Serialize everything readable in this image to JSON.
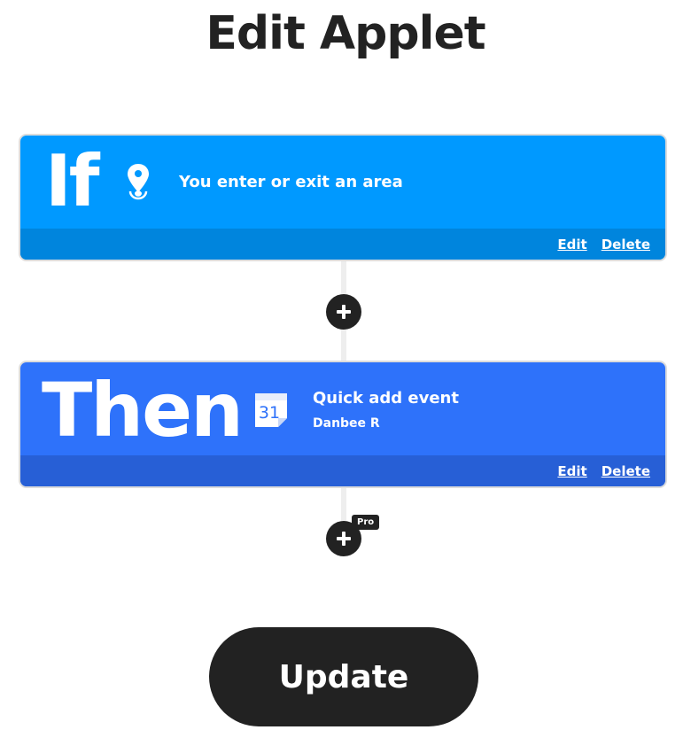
{
  "page": {
    "title": "Edit Applet"
  },
  "trigger": {
    "keyword": "If",
    "icon": "location-pin-icon",
    "title": "You enter or exit an area",
    "edit_label": "Edit",
    "delete_label": "Delete",
    "color": "#0099ff"
  },
  "action": {
    "keyword": "Then",
    "icon": "google-calendar-icon",
    "calendar_day": "31",
    "title": "Quick add event",
    "account": "Danbee R",
    "edit_label": "Edit",
    "delete_label": "Delete",
    "color": "#2e72fa"
  },
  "add_step": {
    "pro_badge": "Pro"
  },
  "update_button": {
    "label": "Update"
  }
}
